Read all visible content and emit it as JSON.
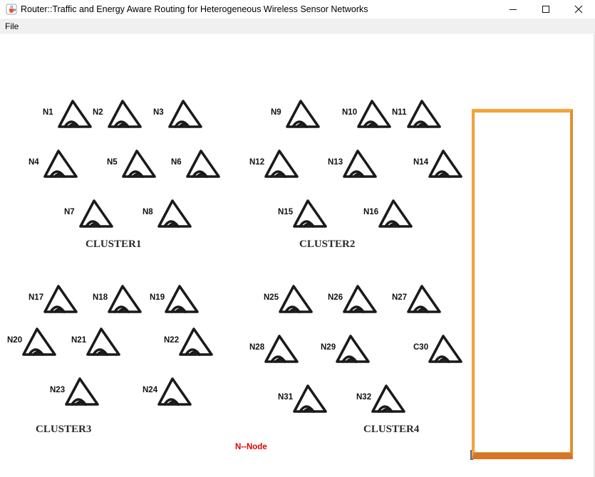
{
  "window": {
    "title": "Router::Traffic and Energy Aware Routing for Heterogeneous Wireless Sensor Networks",
    "controls": [
      "minimize",
      "maximize",
      "close"
    ]
  },
  "menu": {
    "file": "File"
  },
  "nodes": [
    {
      "label": "N1"
    },
    {
      "label": "N2"
    },
    {
      "label": "N3"
    },
    {
      "label": "N4"
    },
    {
      "label": "N5"
    },
    {
      "label": "N6"
    },
    {
      "label": "N7"
    },
    {
      "label": "N8"
    },
    {
      "label": "N9"
    },
    {
      "label": "N10"
    },
    {
      "label": "N11"
    },
    {
      "label": "N12"
    },
    {
      "label": "N13"
    },
    {
      "label": "N14"
    },
    {
      "label": "N15"
    },
    {
      "label": "N16"
    },
    {
      "label": "N17"
    },
    {
      "label": "N18"
    },
    {
      "label": "N19"
    },
    {
      "label": "N20"
    },
    {
      "label": "N21"
    },
    {
      "label": "N22"
    },
    {
      "label": "N23"
    },
    {
      "label": "N24"
    },
    {
      "label": "N25"
    },
    {
      "label": "N26"
    },
    {
      "label": "N27"
    },
    {
      "label": "N28"
    },
    {
      "label": "N29"
    },
    {
      "label": "C30"
    },
    {
      "label": "N31"
    },
    {
      "label": "N32"
    }
  ],
  "clusters": [
    "CLUSTER1",
    "CLUSTER2",
    "CLUSTER3",
    "CLUSTER4"
  ],
  "legend": "N--Node",
  "colors": {
    "legend": "#e00000",
    "panel_border_top": "#f7a638",
    "panel_border_bottom": "#d77527",
    "icon": "#1a1a1a"
  },
  "icons": {
    "node": "signal-node-icon",
    "app": "java-cup-icon"
  }
}
